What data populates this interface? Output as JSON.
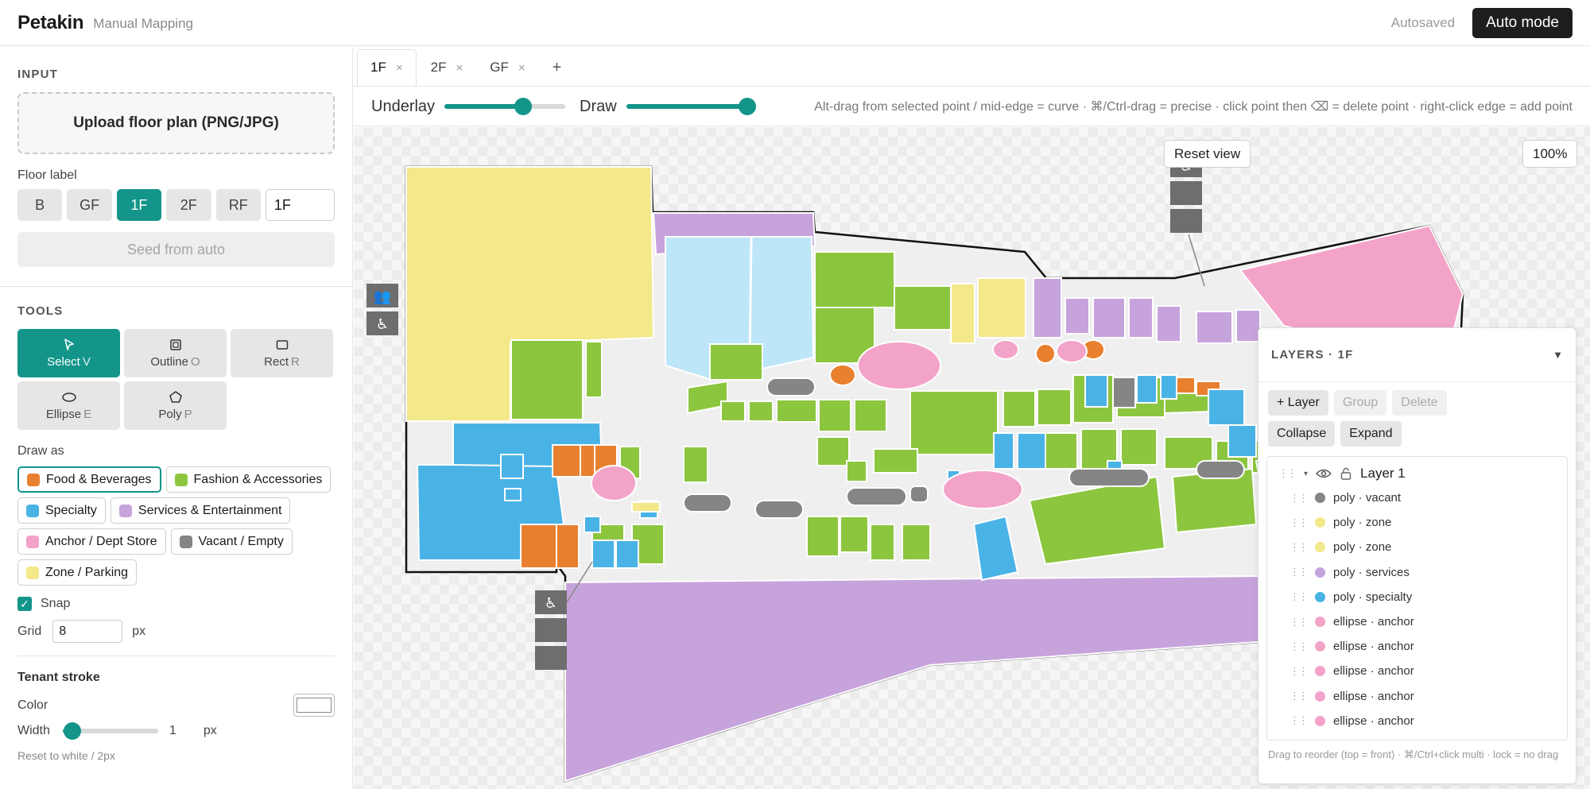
{
  "header": {
    "brand": "Petakin",
    "subtitle": "Manual Mapping",
    "status": "Autosaved",
    "mode_button": "Auto mode"
  },
  "sidebar": {
    "input_title": "INPUT",
    "upload_label": "Upload floor plan (PNG/JPG)",
    "floor_label_title": "Floor label",
    "floors": [
      {
        "label": "B",
        "active": false
      },
      {
        "label": "GF",
        "active": false
      },
      {
        "label": "1F",
        "active": true
      },
      {
        "label": "2F",
        "active": false
      },
      {
        "label": "RF",
        "active": false
      }
    ],
    "floor_input_value": "1F",
    "seed_button": "Seed from auto",
    "tools_title": "TOOLS",
    "tools": [
      {
        "label": "Select",
        "key": "V",
        "icon": "cursor-icon",
        "active": true
      },
      {
        "label": "Outline",
        "key": "O",
        "icon": "outline-icon",
        "active": false
      },
      {
        "label": "Rect",
        "key": "R",
        "icon": "rect-icon",
        "active": false
      },
      {
        "label": "Ellipse",
        "key": "E",
        "icon": "ellipse-icon",
        "active": false
      },
      {
        "label": "Poly",
        "key": "P",
        "icon": "polygon-icon",
        "active": false
      }
    ],
    "draw_as_title": "Draw as",
    "categories": [
      {
        "label": "Food & Beverages",
        "color": "#e8802f",
        "active": true
      },
      {
        "label": "Fashion & Accessories",
        "color": "#8cc63f",
        "active": false
      },
      {
        "label": "Specialty",
        "color": "#4ab3e6",
        "active": false
      },
      {
        "label": "Services & Entertainment",
        "color": "#c7a3dc",
        "active": false
      },
      {
        "label": "Anchor / Dept Store",
        "color": "#f3a3c8",
        "active": false
      },
      {
        "label": "Vacant / Empty",
        "color": "#858585",
        "active": false
      },
      {
        "label": "Zone / Parking",
        "color": "#f3e88a",
        "active": false
      }
    ],
    "snap_label": "Snap",
    "snap_checked": true,
    "grid_label": "Grid",
    "grid_value": "8",
    "grid_unit": "px",
    "stroke_title": "Tenant stroke",
    "color_label": "Color",
    "stroke_color": "#ffffff",
    "width_label": "Width",
    "width_value": "1",
    "width_unit": "px",
    "width_min": 0,
    "width_max": 10,
    "reset_label": "Reset to white / 2px"
  },
  "tabs": [
    {
      "label": "1F",
      "active": true
    },
    {
      "label": "2F",
      "active": false
    },
    {
      "label": "GF",
      "active": false
    }
  ],
  "tab_add": "+",
  "toolbar": {
    "underlay_label": "Underlay",
    "underlay_value": 0.65,
    "draw_label": "Draw",
    "draw_value": 1.0,
    "hint": "Alt-drag from selected point / mid-edge = curve · ⌘/Ctrl-drag = precise · click point then ⌫ = delete point · right-click edge = add point"
  },
  "canvas": {
    "reset_view": "Reset view",
    "zoom": "100%"
  },
  "layers": {
    "title": "LAYERS · 1F",
    "buttons": [
      {
        "label": "+ Layer",
        "disabled": false
      },
      {
        "label": "Group",
        "disabled": true
      },
      {
        "label": "Delete",
        "disabled": true
      },
      {
        "label": "Collapse",
        "disabled": false
      },
      {
        "label": "Expand",
        "disabled": false
      }
    ],
    "group_name": "Layer 1",
    "items": [
      {
        "label": "poly · vacant",
        "color": "#858585"
      },
      {
        "label": "poly · zone",
        "color": "#f3e88a"
      },
      {
        "label": "poly · zone",
        "color": "#f3e88a"
      },
      {
        "label": "poly · services",
        "color": "#c7a3dc"
      },
      {
        "label": "poly · specialty",
        "color": "#4ab3e6"
      },
      {
        "label": "ellipse · anchor",
        "color": "#f3a3c8"
      },
      {
        "label": "ellipse · anchor",
        "color": "#f3a3c8"
      },
      {
        "label": "ellipse · anchor",
        "color": "#f3a3c8"
      },
      {
        "label": "ellipse · anchor",
        "color": "#f3a3c8"
      },
      {
        "label": "ellipse · anchor",
        "color": "#f3a3c8"
      }
    ],
    "footer": "Drag to reorder (top = front) · ⌘/Ctrl+click multi · lock = no drag"
  }
}
